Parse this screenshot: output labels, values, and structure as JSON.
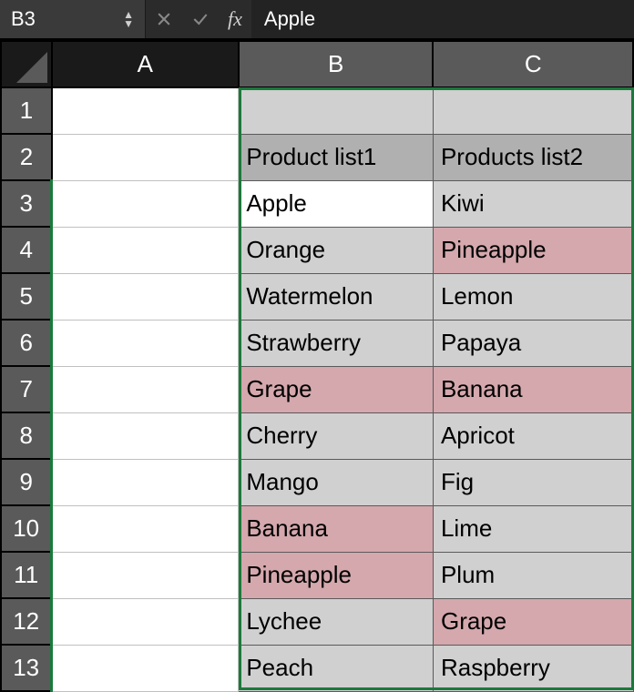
{
  "formulaBar": {
    "cellRef": "B3",
    "fx": "fx",
    "value": "Apple"
  },
  "columns": {
    "a": "A",
    "b": "B",
    "c": "C"
  },
  "rowNumbers": [
    "1",
    "2",
    "3",
    "4",
    "5",
    "6",
    "7",
    "8",
    "9",
    "10",
    "11",
    "12",
    "13"
  ],
  "headers": {
    "b": "Product list1",
    "c": "Products list2"
  },
  "rows": [
    {
      "b": "Apple",
      "c": "Kiwi",
      "bHL": false,
      "cHL": false,
      "bActive": true
    },
    {
      "b": "Orange",
      "c": "Pineapple",
      "bHL": false,
      "cHL": true
    },
    {
      "b": "Watermelon",
      "c": "Lemon",
      "bHL": false,
      "cHL": false
    },
    {
      "b": "Strawberry",
      "c": "Papaya",
      "bHL": false,
      "cHL": false
    },
    {
      "b": "Grape",
      "c": "Banana",
      "bHL": true,
      "cHL": true
    },
    {
      "b": "Cherry",
      "c": "Apricot",
      "bHL": false,
      "cHL": false
    },
    {
      "b": "Mango",
      "c": "Fig",
      "bHL": false,
      "cHL": false
    },
    {
      "b": "Banana",
      "c": "Lime",
      "bHL": true,
      "cHL": false
    },
    {
      "b": "Pineapple",
      "c": "Plum",
      "bHL": true,
      "cHL": false
    },
    {
      "b": "Lychee",
      "c": "Grape",
      "bHL": false,
      "cHL": true
    },
    {
      "b": "Peach",
      "c": "Raspberry",
      "bHL": false,
      "cHL": false
    }
  ]
}
